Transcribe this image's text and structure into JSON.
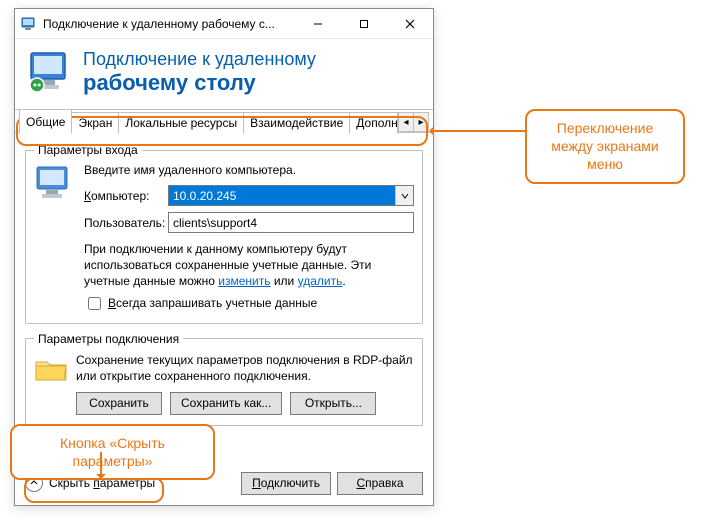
{
  "window": {
    "title": "Подключение к удаленному рабочему с..."
  },
  "header": {
    "line1": "Подключение к удаленному",
    "line2": "рабочему столу"
  },
  "tabs": {
    "items": [
      {
        "label": "Общие"
      },
      {
        "label": "Экран"
      },
      {
        "label": "Локальные ресурсы"
      },
      {
        "label": "Взаимодействие"
      },
      {
        "label": "Дополни"
      }
    ]
  },
  "login": {
    "legend": "Параметры входа",
    "prompt": "Введите имя удаленного компьютера.",
    "computer_label": "Компьютер:",
    "computer_value": "10.0.20.245",
    "user_label": "Пользователь:",
    "user_value": "clients\\support4",
    "notice_1": "При подключении к данному компьютеру будут использоваться сохраненные учетные данные.  Эти учетные данные можно ",
    "link_change": "изменить",
    "notice_or": " или ",
    "link_delete": "удалить",
    "notice_dot": ".",
    "checkbox_label": "Всегда запрашивать учетные данные"
  },
  "conn": {
    "legend": "Параметры подключения",
    "text": "Сохранение текущих параметров подключения в RDP-файл или открытие сохраненного подключения.",
    "save": "Сохранить",
    "save_as": "Сохранить как...",
    "open": "Открыть..."
  },
  "footer": {
    "hide": "Скрыть параметры",
    "connect": "Подключить",
    "help": "Справка"
  },
  "callouts": {
    "tabs": "Переключение между экранами меню",
    "hide": "Кнопка «Скрыть параметры»"
  }
}
